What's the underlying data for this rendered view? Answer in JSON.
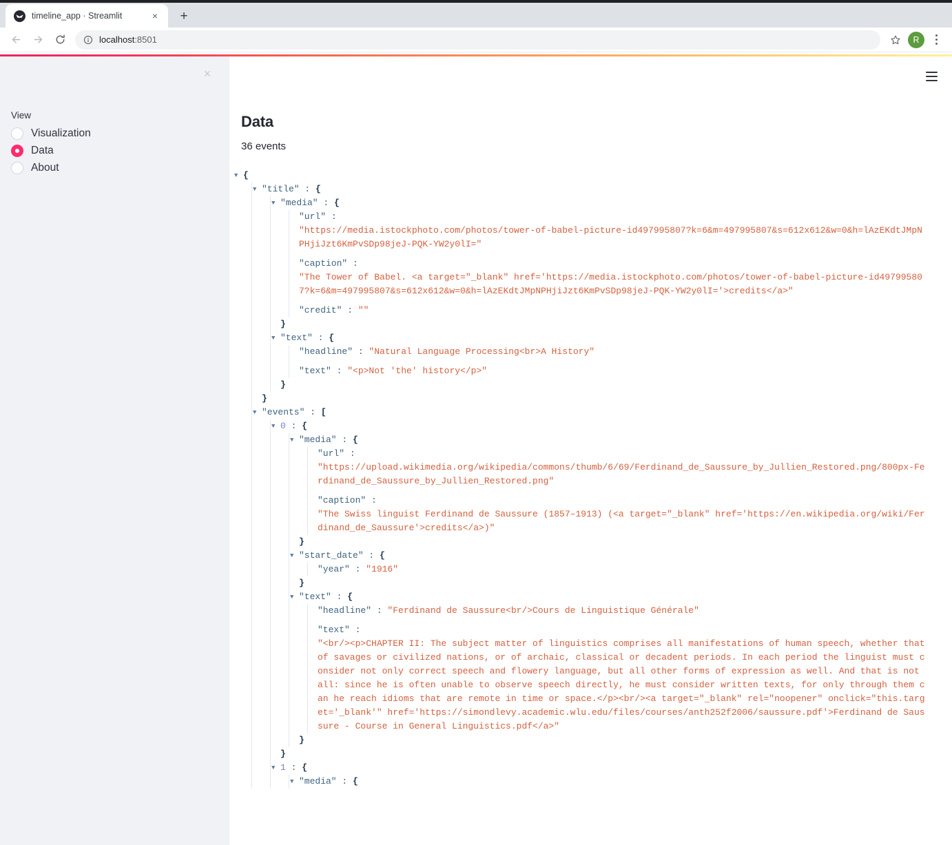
{
  "browser": {
    "tab": {
      "title": "timeline_app · Streamlit",
      "favicon": "streamlit-favicon",
      "close_label": "×"
    },
    "new_tab_label": "+",
    "toolbar": {
      "back_icon": "back-arrow-icon",
      "forward_icon": "forward-arrow-icon",
      "reload_icon": "reload-icon",
      "info_icon": "site-info-icon",
      "url_host": "localhost",
      "url_port": ":8501",
      "star_icon": "bookmark-star-icon",
      "profile_initial": "R",
      "menu_icon": "three-dot-menu-icon"
    }
  },
  "sidebar": {
    "close_label": "×",
    "radio_group_label": "View",
    "options": [
      {
        "label": "Visualization",
        "selected": false
      },
      {
        "label": "Data",
        "selected": true
      },
      {
        "label": "About",
        "selected": false
      }
    ],
    "accent_color": "#ff2b6d",
    "background_color": "#f0f2f6"
  },
  "main": {
    "hamburger_icon": "hamburger-menu-icon",
    "title": "Data",
    "events_count": "36 events"
  },
  "json_tree": {
    "root_open": "{",
    "title_key": "\"title\"",
    "title_open": "{",
    "media_key": "\"media\"",
    "media_open": "{",
    "url_key": "\"url\"",
    "title_media_url": "\"https://media.istockphoto.com/photos/tower-of-babel-picture-id497995807?k=6&m=497995807&s=612x612&w=0&h=lAzEKdtJMpNPHjiJzt6KmPvSDp98jeJ-PQK-YW2y0lI=\"",
    "caption_key": "\"caption\"",
    "title_media_caption": "\"The Tower of Babel. <a target=\"_blank\" href='https://media.istockphoto.com/photos/tower-of-babel-picture-id497995807?k=6&m=497995807&s=612x612&w=0&h=lAzEKdtJMpNPHjiJzt6KmPvSDp98jeJ-PQK-YW2y0lI='>credits</a>\"",
    "credit_key": "\"credit\"",
    "title_media_credit": "\"\"",
    "text_key": "\"text\"",
    "text_open": "{",
    "headline_key": "\"headline\"",
    "title_text_headline": "\"Natural Language Processing<br>A History\"",
    "inner_text_key": "\"text\"",
    "title_text_text": "\"<p>Not 'the' history</p>\"",
    "close_brace": "}",
    "events_key": "\"events\"",
    "events_open": "[",
    "event0_index": "0",
    "event0_open": "{",
    "event0_media_url": "\"https://upload.wikimedia.org/wikipedia/commons/thumb/6/69/Ferdinand_de_Saussure_by_Jullien_Restored.png/800px-Ferdinand_de_Saussure_by_Jullien_Restored.png\"",
    "event0_media_caption": "\"The Swiss linguist Ferdinand de Saussure (1857–1913) (<a target=\"_blank\" href='https://en.wikipedia.org/wiki/Ferdinand_de_Saussure'>credits</a>)\"",
    "start_date_key": "\"start_date\"",
    "start_date_open": "{",
    "year_key": "\"year\"",
    "event0_year": "\"1916\"",
    "event0_text_headline": "\"Ferdinand de Saussure<br/>Cours de Linguistique Générale\"",
    "event0_text_text": "\"<br/><p>CHAPTER II: The subject matter of linguistics comprises all manifestations of human speech, whether that of savages or civilized nations, or of archaic, classical or decadent periods. In each period the linguist must consider not only correct speech and flowery language, but all other forms of expression as well. And that is not all: since he is often unable to observe speech directly, he must consider written texts, for only through them can he reach idioms that are remote in time or space.</p><br/><a target=\"_blank\" rel=\"noopener\" onclick=\"this.target='_blank'\" href='https://simondlevy.academic.wlu.edu/files/courses/anth252f2006/saussure.pdf'>Ferdinand de Saussure - Course in General Linguistics.pdf</a>\"",
    "event1_index": "1",
    "event1_open": "{"
  }
}
